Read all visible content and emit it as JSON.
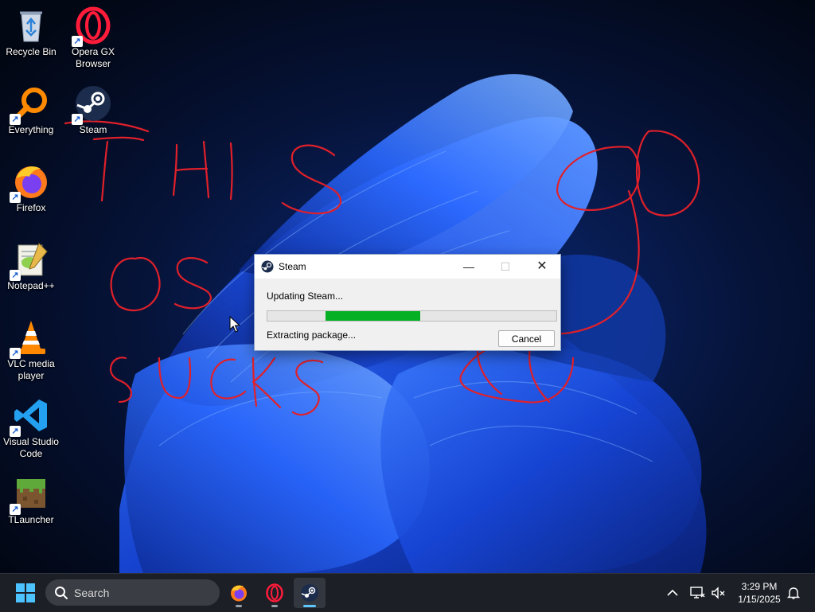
{
  "desktop": {
    "icons": [
      {
        "name": "recycle-bin",
        "label": "Recycle Bin"
      },
      {
        "name": "opera-gx",
        "label": "Opera GX Browser"
      },
      {
        "name": "everything",
        "label": "Everything"
      },
      {
        "name": "steam",
        "label": "Steam"
      },
      {
        "name": "firefox",
        "label": "Firefox"
      },
      {
        "name": "notepad-plus-plus",
        "label": "Notepad++"
      },
      {
        "name": "vlc",
        "label": "VLC media player"
      },
      {
        "name": "vscode",
        "label": "Visual Studio Code"
      },
      {
        "name": "tlauncher",
        "label": "TLauncher"
      }
    ],
    "annotation_color": "#e0202a"
  },
  "dialog": {
    "title": "Steam",
    "message": "Updating Steam...",
    "status": "Extracting package...",
    "cancel_label": "Cancel",
    "progress": {
      "fill_start": 0.2,
      "fill_end": 0.53,
      "color": "#06b025"
    }
  },
  "taskbar": {
    "search_label": "Search",
    "apps": [
      "firefox-icon",
      "opera-gx-icon",
      "steam-icon"
    ],
    "active_app": "steam",
    "time": "3:29 PM",
    "date": "1/15/2025"
  },
  "colors": {
    "accent": "#5cc8ff",
    "taskbar": "#1c1f26"
  }
}
